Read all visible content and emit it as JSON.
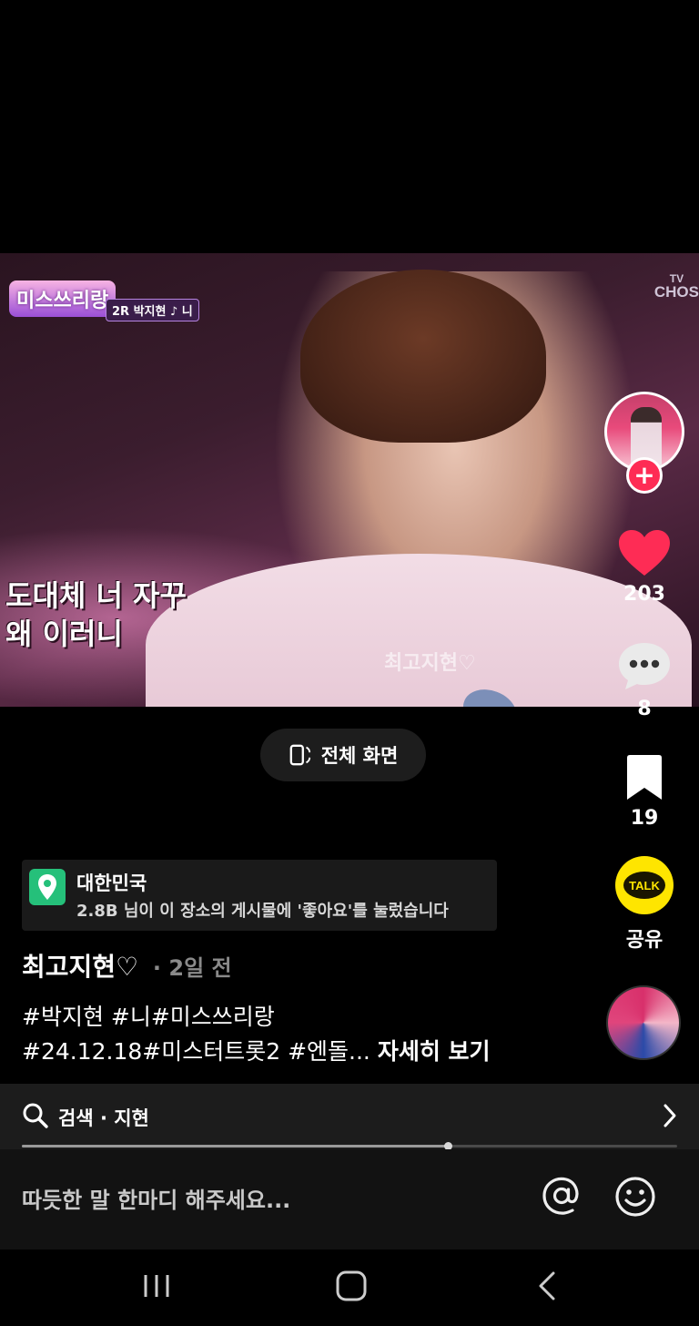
{
  "video": {
    "show_logo": "미스쓰리랑",
    "show_tag": "2R 박지현 ♪ 니",
    "broadcaster_top": "TV",
    "broadcaster_bottom": "CHOS",
    "subtitle_line1": "도대체 너 자꾸",
    "subtitle_line2": "왜 이러니",
    "watermark": "최고지현♡"
  },
  "fullscreen": {
    "label": "전체 화면",
    "icon": "fullscreen-rotate-icon"
  },
  "rail": {
    "likes": "203",
    "comments": "8",
    "bookmarks": "19",
    "share_label": "공유",
    "kakao_label": "TALK",
    "like_color": "#fe2c55",
    "follow_color": "#fe2c55",
    "kakao_color": "#fee500"
  },
  "location": {
    "title": "대한민국",
    "subtitle": "2.8B 님이 이 장소의 게시물에 '좋아요'를 눌렀습니다"
  },
  "post": {
    "author": "최고지현♡",
    "time": "· 2일 전",
    "desc_line1": "#박지현 #니#미스쓰리랑",
    "desc_line2": "#24.12.18#미스터트롯2 #엔돌...",
    "more": "자세히 보기"
  },
  "search": {
    "label": "검색 · 지현",
    "progress": 0.65
  },
  "comment": {
    "placeholder": "따듯한 말 한마디 해주세요..."
  }
}
